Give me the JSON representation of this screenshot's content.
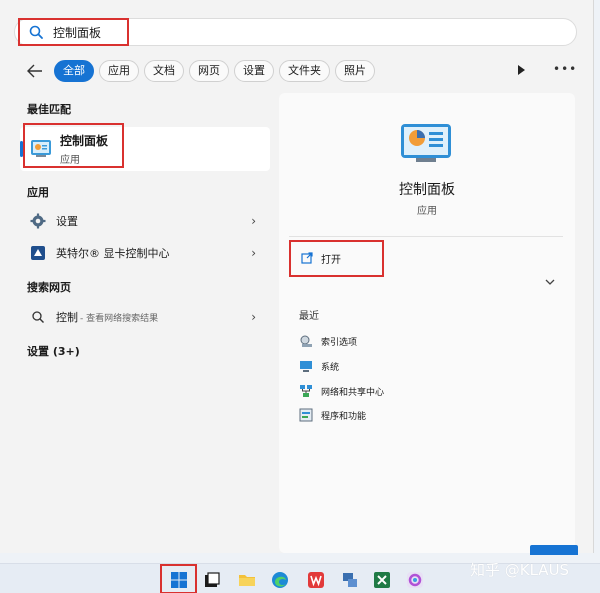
{
  "search": {
    "value": "控制面板"
  },
  "filters": {
    "chips": [
      "全部",
      "应用",
      "文档",
      "网页",
      "设置",
      "文件夹",
      "照片"
    ],
    "active_index": 0
  },
  "sections": {
    "best_match": "最佳匹配",
    "apps": "应用",
    "web": "搜索网页",
    "settings": "设置 (3+)"
  },
  "best_match_item": {
    "name": "控制面板",
    "type": "应用"
  },
  "apps": [
    {
      "label": "设置",
      "icon": "gear-icon"
    },
    {
      "label": "英特尔® 显卡控制中心",
      "icon": "intel-graphics-icon"
    }
  ],
  "web_item": {
    "label": "控制",
    "hint": " - 查看网络搜索结果",
    "icon": "search-icon"
  },
  "detail": {
    "title": "控制面板",
    "subtitle": "应用",
    "open_label": "打开",
    "recent_title": "最近",
    "recent": [
      {
        "label": "索引选项",
        "icon": "indexing-icon"
      },
      {
        "label": "系统",
        "icon": "system-icon"
      },
      {
        "label": "网络和共享中心",
        "icon": "network-icon"
      },
      {
        "label": "程序和功能",
        "icon": "programs-icon"
      }
    ]
  },
  "taskbar": {
    "icons": [
      "windows-start-icon",
      "task-view-icon",
      "file-explorer-icon",
      "edge-icon",
      "wps-icon",
      "network-app-icon",
      "excel-icon",
      "copilot-icon"
    ]
  },
  "watermark": "知乎 @KLAUS",
  "colors": {
    "accent": "#1673d3",
    "highlight_box": "#d9312f"
  }
}
